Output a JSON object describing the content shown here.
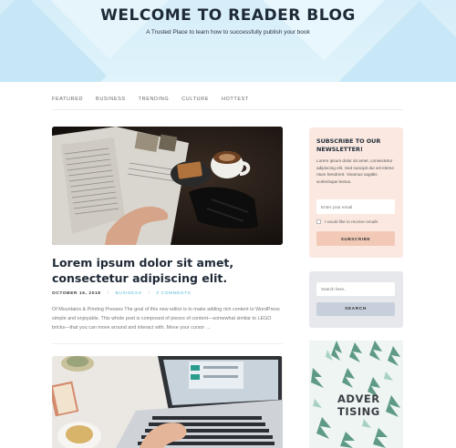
{
  "header": {
    "title": "WELCOME TO READER BLOG",
    "subtitle": "A Trusted Place to learn how to successfully publish your book"
  },
  "nav": {
    "items": [
      "FEATURED",
      "BUSINESS",
      "TRENDING",
      "CULTURE",
      "HOTTEST"
    ]
  },
  "post": {
    "title": "Lorem ipsum dolor sit amet, consectetur adipiscing elit.",
    "date": "OCTOBER 16, 2018",
    "category": "BUSINESS",
    "comments": "0 COMMENTS",
    "excerpt": "Of Mountains & Printing Presses The goal of this new editor is to make adding rich content to WordPress simple and enjoyable. This whole post is composed of pieces of content—somewhat similar to LEGO bricks—that you can move around and interact with. Move your cursor …"
  },
  "newsletter": {
    "title": "SUBSCRIBE TO OUR NEWSLETTER!",
    "text": "Lorem ipsum dolor sit amet, consectetur adipiscing elit. Sed suscipit dui vel eleme ntum hendrerit. Vivamus sagittis scelerisque lectus.",
    "email_placeholder": "Enter your email",
    "consent_label": "I would like to receive emails",
    "button_label": "SUBSCRIBE"
  },
  "search": {
    "placeholder": "Search here..",
    "button_label": "SEARCH"
  },
  "ad": {
    "text": "ADVER TISING"
  },
  "colors": {
    "header_bg": "#d6eef9",
    "accent": "#5bbcd8",
    "newsletter_bg": "#fbe9e1",
    "subscribe_button": "#f1c9b6",
    "search_bg": "#e6e8ec",
    "search_button": "#c8cfdc"
  }
}
